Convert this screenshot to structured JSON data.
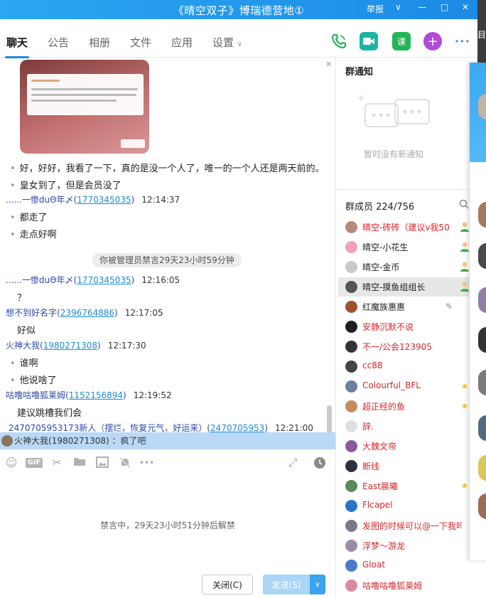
{
  "window": {
    "title": "《晴空双子》博瑞德营地①",
    "report": "举报",
    "dropdown": "∨",
    "minimize": "—",
    "maximize": "□",
    "close": "✕",
    "edge_char": "目"
  },
  "tabs": [
    "聊天",
    "公告",
    "相册",
    "文件",
    "应用",
    "设置"
  ],
  "toolbar_icons": {
    "phone": "phone-icon",
    "video": "video-icon",
    "class_label": "课",
    "plus": "+",
    "more": "•••"
  },
  "messages": {
    "m1": "好，好好，我看了一下，真的是没一个人了，唯一的一个人还是两天前的。",
    "m2": "皇女到了，但是会员没了",
    "s1": {
      "name": "......一惨duΘ年〆(",
      "qq": "1770345035",
      "suffix": ")",
      "time": "12:14:37"
    },
    "m3": "都走了",
    "m4": "走点好啊",
    "system": "你被管理员禁言29天23小时59分钟",
    "s2": {
      "name": "......一惨duΘ年〆(",
      "qq": "1770345035",
      "suffix": ")",
      "time": "12:16:05"
    },
    "m5": "？",
    "s3": {
      "name": "想不到好名字(",
      "qq": "2396764886",
      "suffix": ")",
      "time": "12:17:05"
    },
    "m6": "好似",
    "s4": {
      "name": "火神大我(",
      "qq": "1980271308",
      "suffix": ")",
      "time": "12:17:30"
    },
    "m7": "谁啊",
    "m8": "他说啥了",
    "s5": {
      "name": "咕噜咕噜狐莱姆(",
      "qq": "1152156894",
      "suffix": ")",
      "time": "12:19:52"
    },
    "m9": "建议跳槽我们会",
    "s6": {
      "name": "2470705953173新人（摆烂，恢复元气，好运来）(",
      "qq": "2470705953",
      "suffix": ")",
      "time": "12:21:00"
    },
    "quote": "火神大我(1980271308) ：疯了吧"
  },
  "input_area": {
    "muted_note": "禁言中，29天23小时51分钟后解禁",
    "close_button": "关闭(C)",
    "send_button": "发送(S)",
    "gif": "GIF"
  },
  "notice": {
    "title": "群通知",
    "empty": "暂时没有新通知"
  },
  "members": {
    "title": "群成员 224/756",
    "list": [
      {
        "name": "晴空-砖砖（建议v我50",
        "color": "#d9262b",
        "badge": "admin"
      },
      {
        "name": "晴空-小花生",
        "color": "#222222",
        "badge": "admin"
      },
      {
        "name": "晴空-金币",
        "color": "#222222",
        "badge": "admin"
      },
      {
        "name": "晴空-摸鱼组组长",
        "color": "#222222",
        "badge": "admin"
      },
      {
        "name": "红魔族惠惠",
        "color": "#222222",
        "badge": "edit"
      },
      {
        "name": "安静沉默不说",
        "color": "#d9262b",
        "badge": ""
      },
      {
        "name": "不一/公会123905",
        "color": "#d9262b",
        "badge": ""
      },
      {
        "name": "cc88",
        "color": "#d9262b",
        "badge": ""
      },
      {
        "name": "Colourful_BFL",
        "color": "#d9262b",
        "badge": "star"
      },
      {
        "name": "超正经的鱼",
        "color": "#d9262b",
        "badge": "star"
      },
      {
        "name": "辞.",
        "color": "#d9262b",
        "badge": ""
      },
      {
        "name": "大魏文帝",
        "color": "#d9262b",
        "badge": ""
      },
      {
        "name": "断线",
        "color": "#d9262b",
        "badge": ""
      },
      {
        "name": "East晨曦",
        "color": "#d9262b",
        "badge": "star"
      },
      {
        "name": "Flcapel",
        "color": "#d9262b",
        "badge": ""
      },
      {
        "name": "发图的时候可以@一下我吗",
        "color": "#d9262b",
        "badge": ""
      },
      {
        "name": "浮梦～游龙",
        "color": "#d9262b",
        "badge": ""
      },
      {
        "name": "Gloat",
        "color": "#d9262b",
        "badge": ""
      },
      {
        "name": "咕噜咕噜狐莱姆",
        "color": "#d9262b",
        "badge": ""
      }
    ]
  }
}
